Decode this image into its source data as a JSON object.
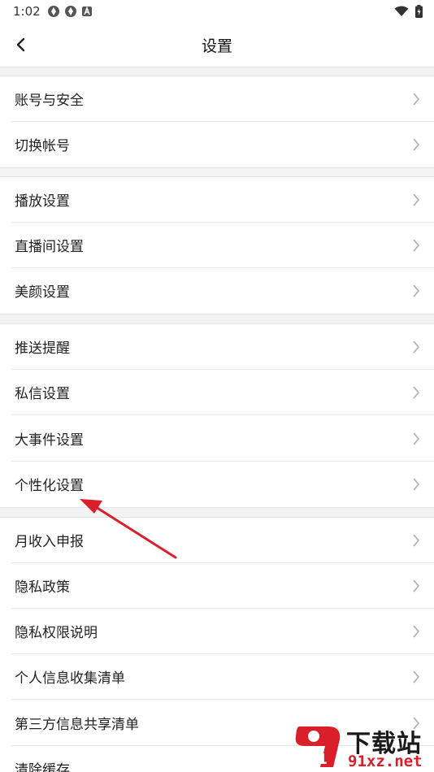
{
  "status_bar": {
    "time": "1:02"
  },
  "nav": {
    "title": "设置"
  },
  "groups": [
    {
      "items": [
        {
          "label": "账号与安全"
        },
        {
          "label": "切换帐号"
        }
      ]
    },
    {
      "items": [
        {
          "label": "播放设置"
        },
        {
          "label": "直播间设置"
        },
        {
          "label": "美颜设置"
        }
      ]
    },
    {
      "items": [
        {
          "label": "推送提醒"
        },
        {
          "label": "私信设置"
        },
        {
          "label": "大事件设置"
        },
        {
          "label": "个性化设置"
        }
      ]
    },
    {
      "items": [
        {
          "label": "月收入申报"
        },
        {
          "label": "隐私政策"
        },
        {
          "label": "隐私权限说明"
        },
        {
          "label": "个人信息收集清单"
        },
        {
          "label": "第三方信息共享清单"
        },
        {
          "label": "清除缓存"
        }
      ]
    }
  ],
  "watermark": {
    "brand": "下载站",
    "site": "91xz.net",
    "logo_text": "91"
  },
  "colors": {
    "annotation_arrow": "#d9202a",
    "separator": "#f3f3f3",
    "chevron": "#b5b5b5"
  }
}
